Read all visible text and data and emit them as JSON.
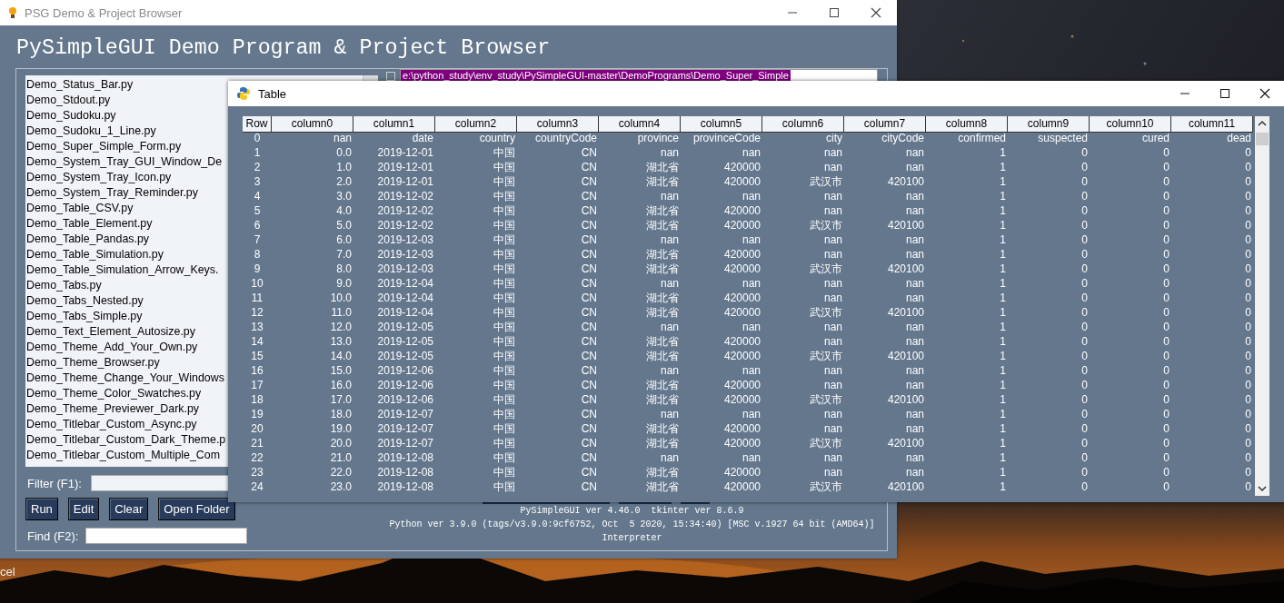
{
  "desktop": {
    "label": "cel"
  },
  "main_window": {
    "title": "PSG Demo & Project Browser",
    "heading": "PySimpleGUI Demo Program & Project Browser",
    "files": [
      "Demo_Status_Bar.py",
      "Demo_Stdout.py",
      "Demo_Sudoku.py",
      "Demo_Sudoku_1_Line.py",
      "Demo_Super_Simple_Form.py",
      "Demo_System_Tray_GUI_Window_De",
      "Demo_System_Tray_Icon.py",
      "Demo_System_Tray_Reminder.py",
      "Demo_Table_CSV.py",
      "Demo_Table_Element.py",
      "Demo_Table_Pandas.py",
      "Demo_Table_Simulation.py",
      "Demo_Table_Simulation_Arrow_Keys.",
      "Demo_Tabs.py",
      "Demo_Tabs_Nested.py",
      "Demo_Tabs_Simple.py",
      "Demo_Text_Element_Autosize.py",
      "Demo_Theme_Add_Your_Own.py",
      "Demo_Theme_Browser.py",
      "Demo_Theme_Change_Your_Windows",
      "Demo_Theme_Color_Swatches.py",
      "Demo_Theme_Previewer_Dark.py",
      "Demo_Titlebar_Custom_Async.py",
      "Demo_Titlebar_Custom_Dark_Theme.p",
      "Demo_Titlebar_Custom_Multiple_Com"
    ],
    "path_checkbox": {
      "checked": false
    },
    "path_field": {
      "value": "e:\\python_study\\env_study\\PySimpleGUI-master\\DemoPrograms\\Demo_Super_Simple"
    },
    "filter": {
      "label": "Filter (F1):"
    },
    "buttons": [
      "Run",
      "Edit",
      "Clear",
      "Open Folder"
    ],
    "find": {
      "label": "Find (F2):"
    },
    "version_lines": [
      "PySimpleGUI ver 4.46.0  tkinter ver 8.6.9",
      "Python ver 3.9.0 (tags/v3.9.0:9cf6752, Oct  5 2020, 15:34:40) [MSC v.1927 64 bit (AMD64)]",
      "Interpreter"
    ]
  },
  "table_window": {
    "title": "Table",
    "table": {
      "columns": [
        "Row",
        "column0",
        "column1",
        "column2",
        "column3",
        "column4",
        "column5",
        "column6",
        "column7",
        "column8",
        "column9",
        "column10",
        "column11"
      ],
      "rows": [
        [
          "0",
          "nan",
          "date",
          "country",
          "countryCode",
          "province",
          "provinceCode",
          "city",
          "cityCode",
          "confirmed",
          "suspected",
          "cured",
          "dead"
        ],
        [
          "1",
          "0.0",
          "2019-12-01",
          "中国",
          "CN",
          "nan",
          "nan",
          "nan",
          "nan",
          "1",
          "0",
          "0",
          "0"
        ],
        [
          "2",
          "1.0",
          "2019-12-01",
          "中国",
          "CN",
          "湖北省",
          "420000",
          "nan",
          "nan",
          "1",
          "0",
          "0",
          "0"
        ],
        [
          "3",
          "2.0",
          "2019-12-01",
          "中国",
          "CN",
          "湖北省",
          "420000",
          "武汉市",
          "420100",
          "1",
          "0",
          "0",
          "0"
        ],
        [
          "4",
          "3.0",
          "2019-12-02",
          "中国",
          "CN",
          "nan",
          "nan",
          "nan",
          "nan",
          "1",
          "0",
          "0",
          "0"
        ],
        [
          "5",
          "4.0",
          "2019-12-02",
          "中国",
          "CN",
          "湖北省",
          "420000",
          "nan",
          "nan",
          "1",
          "0",
          "0",
          "0"
        ],
        [
          "6",
          "5.0",
          "2019-12-02",
          "中国",
          "CN",
          "湖北省",
          "420000",
          "武汉市",
          "420100",
          "1",
          "0",
          "0",
          "0"
        ],
        [
          "7",
          "6.0",
          "2019-12-03",
          "中国",
          "CN",
          "nan",
          "nan",
          "nan",
          "nan",
          "1",
          "0",
          "0",
          "0"
        ],
        [
          "8",
          "7.0",
          "2019-12-03",
          "中国",
          "CN",
          "湖北省",
          "420000",
          "nan",
          "nan",
          "1",
          "0",
          "0",
          "0"
        ],
        [
          "9",
          "8.0",
          "2019-12-03",
          "中国",
          "CN",
          "湖北省",
          "420000",
          "武汉市",
          "420100",
          "1",
          "0",
          "0",
          "0"
        ],
        [
          "10",
          "9.0",
          "2019-12-04",
          "中国",
          "CN",
          "nan",
          "nan",
          "nan",
          "nan",
          "1",
          "0",
          "0",
          "0"
        ],
        [
          "11",
          "10.0",
          "2019-12-04",
          "中国",
          "CN",
          "湖北省",
          "420000",
          "nan",
          "nan",
          "1",
          "0",
          "0",
          "0"
        ],
        [
          "12",
          "11.0",
          "2019-12-04",
          "中国",
          "CN",
          "湖北省",
          "420000",
          "武汉市",
          "420100",
          "1",
          "0",
          "0",
          "0"
        ],
        [
          "13",
          "12.0",
          "2019-12-05",
          "中国",
          "CN",
          "nan",
          "nan",
          "nan",
          "nan",
          "1",
          "0",
          "0",
          "0"
        ],
        [
          "14",
          "13.0",
          "2019-12-05",
          "中国",
          "CN",
          "湖北省",
          "420000",
          "nan",
          "nan",
          "1",
          "0",
          "0",
          "0"
        ],
        [
          "15",
          "14.0",
          "2019-12-05",
          "中国",
          "CN",
          "湖北省",
          "420000",
          "武汉市",
          "420100",
          "1",
          "0",
          "0",
          "0"
        ],
        [
          "16",
          "15.0",
          "2019-12-06",
          "中国",
          "CN",
          "nan",
          "nan",
          "nan",
          "nan",
          "1",
          "0",
          "0",
          "0"
        ],
        [
          "17",
          "16.0",
          "2019-12-06",
          "中国",
          "CN",
          "湖北省",
          "420000",
          "nan",
          "nan",
          "1",
          "0",
          "0",
          "0"
        ],
        [
          "18",
          "17.0",
          "2019-12-06",
          "中国",
          "CN",
          "湖北省",
          "420000",
          "武汉市",
          "420100",
          "1",
          "0",
          "0",
          "0"
        ],
        [
          "19",
          "18.0",
          "2019-12-07",
          "中国",
          "CN",
          "nan",
          "nan",
          "nan",
          "nan",
          "1",
          "0",
          "0",
          "0"
        ],
        [
          "20",
          "19.0",
          "2019-12-07",
          "中国",
          "CN",
          "湖北省",
          "420000",
          "nan",
          "nan",
          "1",
          "0",
          "0",
          "0"
        ],
        [
          "21",
          "20.0",
          "2019-12-07",
          "中国",
          "CN",
          "湖北省",
          "420000",
          "武汉市",
          "420100",
          "1",
          "0",
          "0",
          "0"
        ],
        [
          "22",
          "21.0",
          "2019-12-08",
          "中国",
          "CN",
          "nan",
          "nan",
          "nan",
          "nan",
          "1",
          "0",
          "0",
          "0"
        ],
        [
          "23",
          "22.0",
          "2019-12-08",
          "中国",
          "CN",
          "湖北省",
          "420000",
          "nan",
          "nan",
          "1",
          "0",
          "0",
          "0"
        ],
        [
          "24",
          "23.0",
          "2019-12-08",
          "中国",
          "CN",
          "湖北省",
          "420000",
          "武汉市",
          "420100",
          "1",
          "0",
          "0",
          "0"
        ]
      ]
    }
  }
}
